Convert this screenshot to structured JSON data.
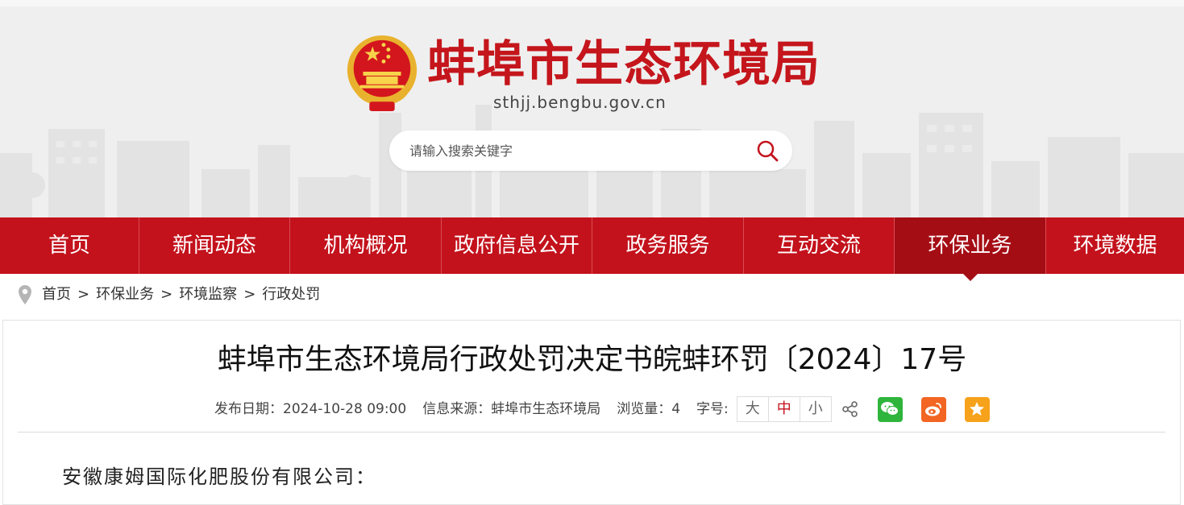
{
  "header": {
    "site_title": "蚌埠市生态环境局",
    "domain": "sthjj.bengbu.gov.cn",
    "search_placeholder": "请输入搜索关键字",
    "emblem_icon": "national-emblem-icon"
  },
  "nav": {
    "items": [
      {
        "label": "首页"
      },
      {
        "label": "新闻动态"
      },
      {
        "label": "机构概况"
      },
      {
        "label": "政府信息公开"
      },
      {
        "label": "政务服务"
      },
      {
        "label": "互动交流"
      },
      {
        "label": "环保业务",
        "active": true
      },
      {
        "label": "环境数据"
      }
    ]
  },
  "breadcrumb": {
    "icon": "location-pin-icon",
    "items": [
      "首页",
      "环保业务",
      "环境监察",
      "行政处罚"
    ],
    "separator": ">"
  },
  "article": {
    "title": "蚌埠市生态环境局行政处罚决定书皖蚌环罚〔2024〕17号",
    "publish_date": "发布日期：2024-10-28 09:00",
    "source": "信息来源：蚌埠市生态环境局",
    "views": "浏览量：4",
    "font_size_label": "字号:",
    "font_sizes": [
      "大",
      "中",
      "小"
    ],
    "active_font_size": "中",
    "addressee": "安徽康姆国际化肥股份有限公司："
  },
  "colors": {
    "brand_red": "#c3121c",
    "nav_active": "#a50d15",
    "wechat_green": "#2fb53c",
    "weibo_orange": "#f26522",
    "favorite_yellow": "#f7a21b"
  }
}
